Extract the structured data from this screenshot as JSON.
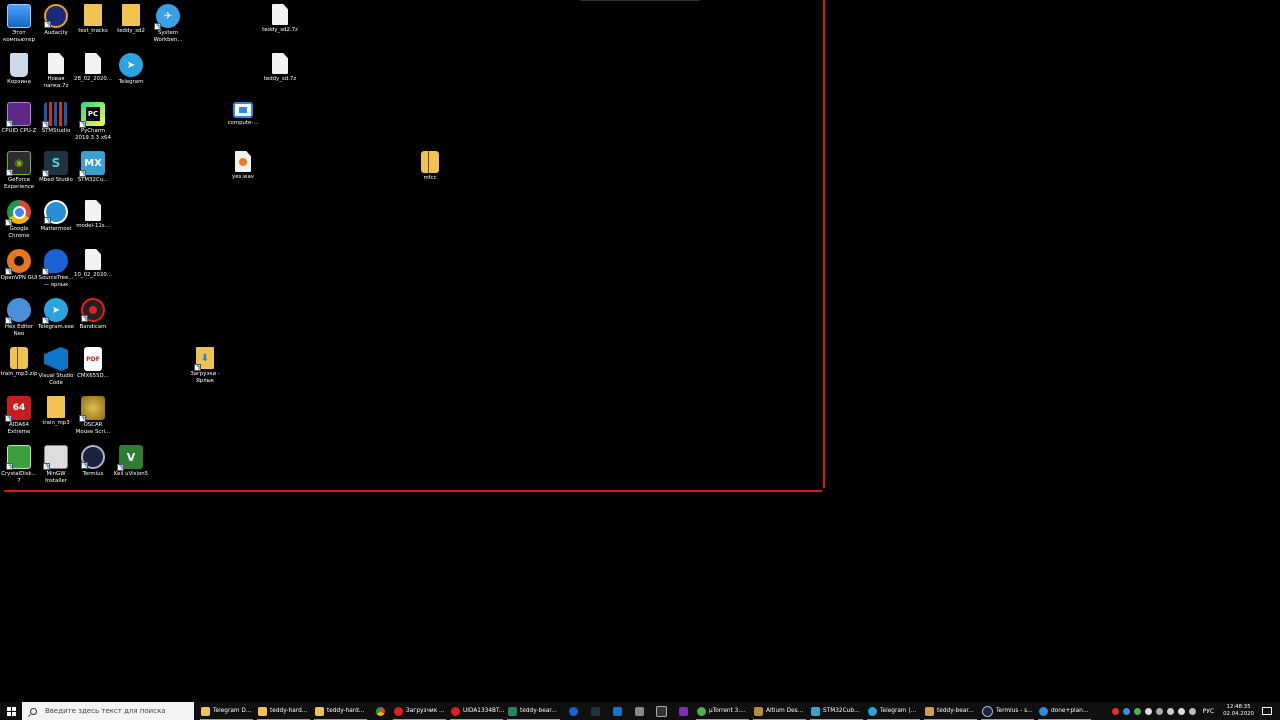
{
  "desktop": {
    "icons": {
      "this_pc": "Этот компьютер",
      "audacity": "Audacity",
      "test_tracks": "test_tracks",
      "teddy_sd2": "teddy_sd2",
      "system_workbench": "System Workben...",
      "teddy_sd2_7z": "teddy_sd2.7z",
      "recycle_bin": "Корзина",
      "new_folder_7z": "Новая папка.7z",
      "file_28_02": "28_02_2020...",
      "telegram": "Telegram",
      "teddy_sd_7z": "teddy_sd.7z",
      "cpuid": "CPUID CPU-Z",
      "stmstudio": "STMStudio",
      "pycharm": "PyCharm 2019.3.3 x64",
      "compute": "compute-...",
      "geforce": "GeForce Experience",
      "mbed": "Mbed Studio",
      "stm32cube": "STM32Cu...",
      "yes_wav": "yes.wav",
      "mfcc": "mfcc",
      "chrome": "Google Chrome",
      "mattermost": "Mattermost",
      "model": "model-11s...",
      "openvpn": "OpenVPN GUI",
      "sourcetree": "SourceTree... — ярлык",
      "file_10_02": "10_02_2020...",
      "hex_editor": "Hex Editor Neo",
      "telegram_exe": "Telegram.exe",
      "bandicam": "Bandicam",
      "train_mp3_zip": "train_mp3.zip",
      "vscode": "Visual Studio Code",
      "cmx_pdf": "CMX655D...",
      "downloads": "Загрузки - Ярлык",
      "aida64": "AIDA64 Extreme",
      "train_mp3": "train_mp3",
      "oscar": "OSCAR Mouse Scri...",
      "crystaldisk": "CrystalDisk... 7",
      "mingw": "MinGW Installer",
      "termius": "Termius",
      "keil": "Keil uVision5"
    }
  },
  "taskbar": {
    "search_placeholder": "Введите здесь текст для поиска",
    "tasks": {
      "telegram_d": "Telegram D...",
      "teddy_hard1": "teddy-hard...",
      "teddy_hard2": "teddy-hard...",
      "zagruzchik": "Загрузчик ...",
      "uida": "UIDA1334BT...",
      "teddy_bear1": "teddy-bear...",
      "utorrent": "µTorrent 3....",
      "altium": "Altium Des...",
      "stm32cub": "STM32Cub...",
      "telegram2": "Telegram (...",
      "teddy_bear2": "teddy-bear...",
      "termius": "Termius - s...",
      "done_plan": "done+plan..."
    },
    "language": "РУС",
    "time": "12:48:35",
    "date": "02.04.2020"
  },
  "colors": {
    "desktop_bg": "#000000",
    "red_border": "#e01414",
    "taskbar_bg": "#101010"
  }
}
